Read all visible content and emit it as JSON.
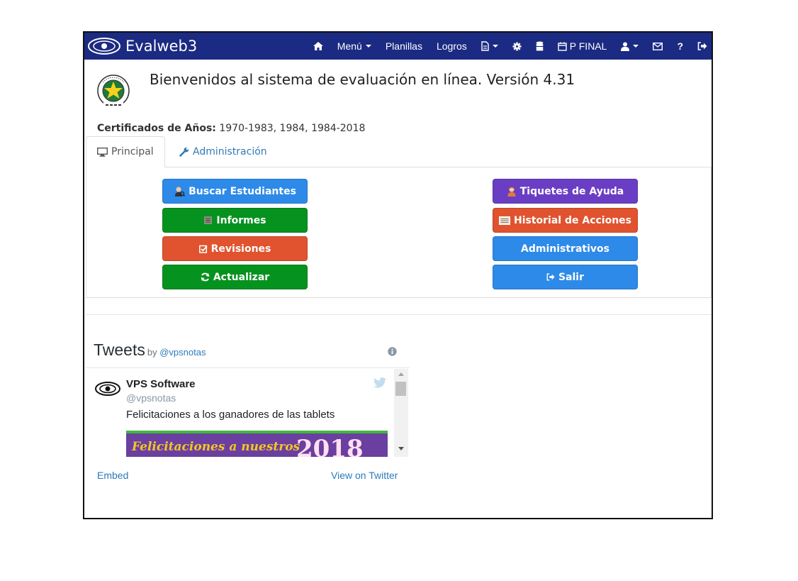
{
  "app": {
    "title": "Evalweb3"
  },
  "nav": {
    "menu_label": "Menú",
    "planillas_label": "Planillas",
    "logros_label": "Logros",
    "period_label": "P FINAL",
    "help_label": "?"
  },
  "header": {
    "welcome": "Bienvenidos al sistema de evaluación en línea. Versión 4.31",
    "certs_label": "Certificados de Años:",
    "certs_value": "1970-1983, 1984, 1984-2018"
  },
  "tabs": [
    {
      "label": "Principal",
      "icon": "monitor-icon",
      "active": true
    },
    {
      "label": "Administración",
      "icon": "wrench-icon",
      "active": false
    }
  ],
  "buttons": {
    "buscar": "Buscar Estudiantes",
    "informes": "Informes",
    "revisiones": "Revisiones",
    "actualizar": "Actualizar",
    "tiquetes": "Tiquetes de Ayuda",
    "historial": "Historial de Acciones",
    "administrativos": "Administrativos",
    "salir": "Salir"
  },
  "colors": {
    "navbar": "#1b2a82",
    "primary": "#2d8ae8",
    "success": "#06921e",
    "danger": "#e0532e",
    "purple": "#6a3ec4"
  },
  "twitter": {
    "heading": "Tweets",
    "by": "by",
    "handle_link": "@vpsnotas",
    "name": "VPS Software",
    "username": "@vpsnotas",
    "text": "Felicitaciones a los ganadores de las tablets",
    "image_caption": "Felicitaciones a nuestros",
    "image_year": "2018",
    "embed": "Embed",
    "view_on_twitter": "View on Twitter"
  }
}
